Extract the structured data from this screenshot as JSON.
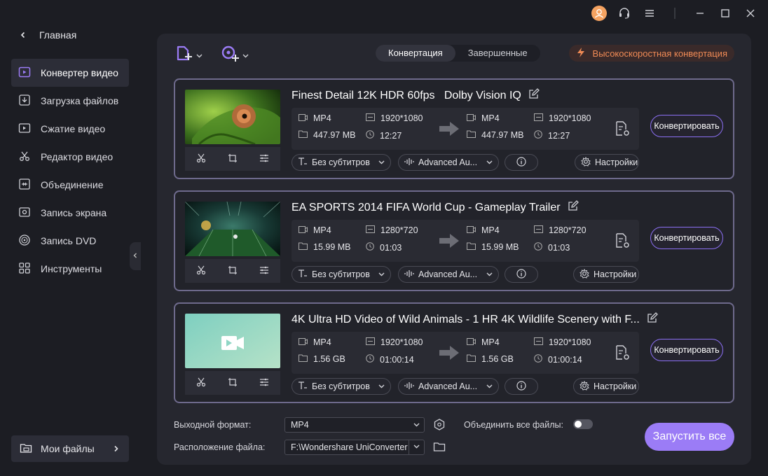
{
  "sidebar": {
    "home_label": "Главная",
    "items": [
      {
        "label": "Конвертер видео",
        "icon": "video-converter-icon",
        "active": true
      },
      {
        "label": "Загрузка файлов",
        "icon": "download-icon",
        "active": false
      },
      {
        "label": "Сжатие видео",
        "icon": "compress-icon",
        "active": false
      },
      {
        "label": "Редактор видео",
        "icon": "scissors-icon",
        "active": false
      },
      {
        "label": "Объединение",
        "icon": "merge-icon",
        "active": false
      },
      {
        "label": "Запись экрана",
        "icon": "screen-record-icon",
        "active": false
      },
      {
        "label": "Запись DVD",
        "icon": "dvd-icon",
        "active": false
      },
      {
        "label": "Инструменты",
        "icon": "toolbox-icon",
        "active": false
      }
    ],
    "my_files_label": "Мои файлы"
  },
  "toolbar": {
    "tabs": [
      {
        "label": "Конвертация",
        "active": true
      },
      {
        "label": "Завершенные",
        "active": false
      }
    ],
    "fast_convert_label": "Высокоскоростная конвертация"
  },
  "files": [
    {
      "title": "Finest Detail 12K HDR 60fps   Dolby Vision IQ",
      "src_format": "MP4",
      "src_resolution": "1920*1080",
      "src_size": "447.97 MB",
      "src_duration": "12:27",
      "dst_format": "MP4",
      "dst_resolution": "1920*1080",
      "dst_size": "447.97 MB",
      "dst_duration": "12:27",
      "subtitle": "Без субтитров",
      "audio": "Advanced Au...",
      "settings": "Настройки",
      "convert": "Конвертировать"
    },
    {
      "title": "EA SPORTS 2014 FIFA World Cup - Gameplay Trailer",
      "src_format": "MP4",
      "src_resolution": "1280*720",
      "src_size": "15.99 MB",
      "src_duration": "01:03",
      "dst_format": "MP4",
      "dst_resolution": "1280*720",
      "dst_size": "15.99 MB",
      "dst_duration": "01:03",
      "subtitle": "Без субтитров",
      "audio": "Advanced Au...",
      "settings": "Настройки",
      "convert": "Конвертировать"
    },
    {
      "title": "4K Ultra HD Video of Wild Animals - 1 HR 4K Wildlife Scenery with F...",
      "src_format": "MP4",
      "src_resolution": "1920*1080",
      "src_size": "1.56 GB",
      "src_duration": "01:00:14",
      "dst_format": "MP4",
      "dst_resolution": "1920*1080",
      "dst_size": "1.56 GB",
      "dst_duration": "01:00:14",
      "subtitle": "Без субтитров",
      "audio": "Advanced Au...",
      "settings": "Настройки",
      "convert": "Конвертировать"
    }
  ],
  "bottom": {
    "output_format_label": "Выходной формат:",
    "output_format_value": "MP4",
    "merge_label": "Объединить все файлы:",
    "merge_enabled": false,
    "location_label": "Расположение файла:",
    "location_value": "F:\\Wondershare UniConverter",
    "start_all_label": "Запустить все"
  },
  "colors": {
    "accent": "#9b7cf6",
    "card_border": "#6e6a8c",
    "fast_text": "#f08a55",
    "avatar": "#f5a361"
  }
}
